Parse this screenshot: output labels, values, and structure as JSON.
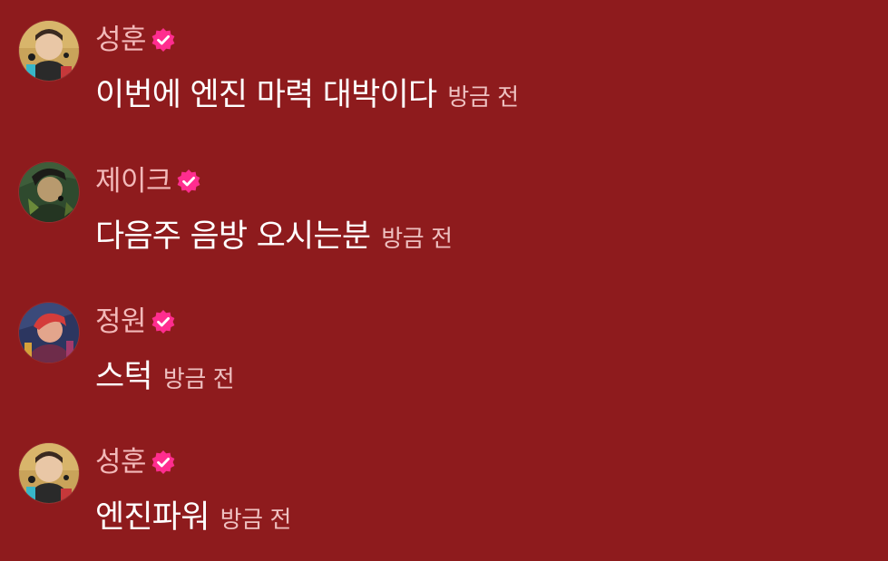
{
  "colors": {
    "background": "#8e1b1d",
    "username": "#f2b9b9",
    "message": "#ffffff",
    "timestamp": "#eec0c0",
    "verified_badge": "#ff2d8f"
  },
  "messages": [
    {
      "username": "성훈",
      "verified": true,
      "avatar": "profile-photo",
      "text": "이번에 엔진 마력 대박이다",
      "time": "방금 전"
    },
    {
      "username": "제이크",
      "verified": true,
      "avatar": "profile-photo",
      "text": "다음주 음방 오시는분",
      "time": "방금 전"
    },
    {
      "username": "정원",
      "verified": true,
      "avatar": "profile-photo",
      "text": "스턱",
      "time": "방금 전"
    },
    {
      "username": "성훈",
      "verified": true,
      "avatar": "profile-photo",
      "text": "엔진파워",
      "time": "방금 전"
    }
  ]
}
